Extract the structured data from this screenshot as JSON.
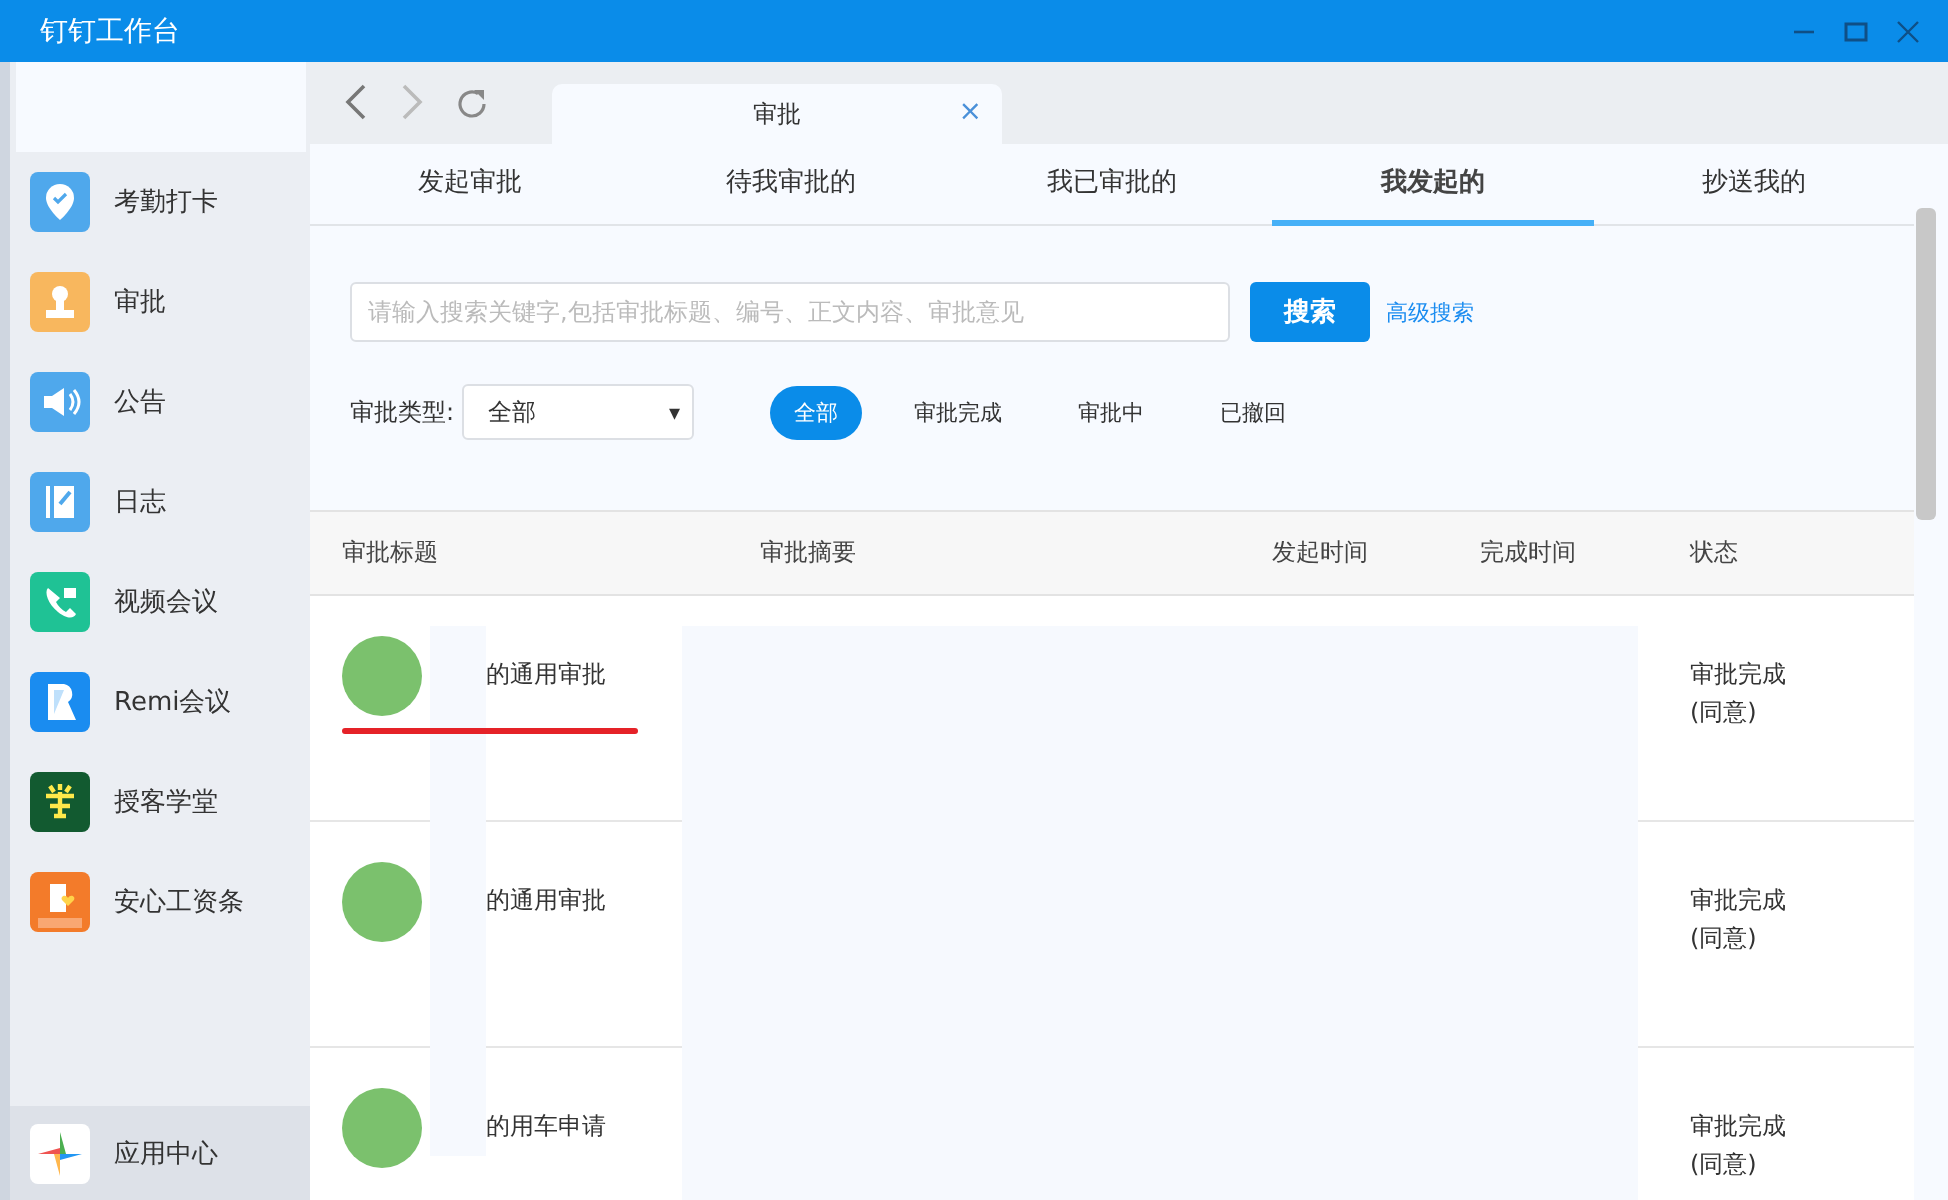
{
  "window": {
    "title": "钉钉工作台"
  },
  "sidebar": {
    "items": [
      {
        "label": "考勤打卡",
        "kind": "pin",
        "color": "#4fa8ec",
        "selected": false
      },
      {
        "label": "审批",
        "kind": "stamp",
        "color": "#f8b75e",
        "selected": false
      },
      {
        "label": "公告",
        "kind": "speaker",
        "color": "#4fa8ec",
        "selected": false
      },
      {
        "label": "日志",
        "kind": "note",
        "color": "#4fa8ec",
        "selected": false
      },
      {
        "label": "视频会议",
        "kind": "phone",
        "color": "#1fc295",
        "selected": false
      },
      {
        "label": "Remi会议",
        "kind": "remi",
        "color": "#1a8cf0",
        "selected": false
      },
      {
        "label": "授客学堂",
        "kind": "learn",
        "color": "#125a30",
        "selected": false
      },
      {
        "label": "安心工资条",
        "kind": "pay",
        "color": "#f37b2a",
        "selected": false
      }
    ],
    "footer_item": {
      "label": "应用中心",
      "selected": true
    }
  },
  "browser_tab": {
    "title": "审批",
    "close": "×"
  },
  "tabs": [
    {
      "label": "发起审批",
      "selected": false
    },
    {
      "label": "待我审批的",
      "selected": false
    },
    {
      "label": "我已审批的",
      "selected": false
    },
    {
      "label": "我发起的",
      "selected": true
    },
    {
      "label": "抄送我的",
      "selected": false
    }
  ],
  "search": {
    "placeholder": "请输入搜索关键字,包括审批标题、编号、正文内容、审批意见",
    "button": "搜索",
    "advanced_link": "高级搜索"
  },
  "filter": {
    "type_label": "审批类型:",
    "type_value": "全部",
    "caret": "▾",
    "statuses": [
      {
        "label": "全部",
        "selected": true
      },
      {
        "label": "审批完成",
        "selected": false
      },
      {
        "label": "审批中",
        "selected": false
      },
      {
        "label": "已撤回",
        "selected": false
      }
    ]
  },
  "table": {
    "columns": [
      "审批标题",
      "审批摘要",
      "发起时间",
      "完成时间",
      "状态"
    ],
    "rows": [
      {
        "title": "的通用审批",
        "status": "审批完成",
        "status_note": "(同意)",
        "underlined": true
      },
      {
        "title": "的通用审批",
        "status": "审批完成",
        "status_note": "(同意)",
        "underlined": false
      },
      {
        "title": "的用车申请",
        "status": "审批完成",
        "status_note": "(同意)",
        "underlined": false
      }
    ]
  }
}
